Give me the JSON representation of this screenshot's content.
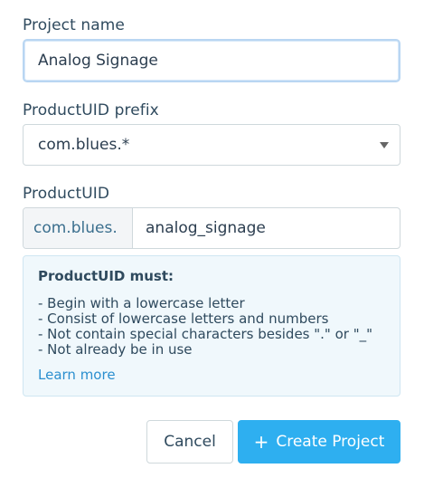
{
  "project_name": {
    "label": "Project name",
    "value": "Analog Signage"
  },
  "prefix": {
    "label": "ProductUID prefix",
    "selected": "com.blues.*"
  },
  "product_uid": {
    "label": "ProductUID",
    "prefix": "com.blues.",
    "value": "analog_signage"
  },
  "info": {
    "title": "ProductUID must:",
    "rules": [
      "- Begin with a lowercase letter",
      "- Consist of lowercase letters and numbers",
      "- Not contain special characters besides \".\" or \"_\"",
      "- Not already be in use"
    ],
    "learn_more": "Learn more"
  },
  "buttons": {
    "cancel": "Cancel",
    "create_icon": "+",
    "create": "Create Project"
  },
  "colors": {
    "accent": "#2eaff0",
    "link": "#2b8fcf",
    "info_bg": "#f0f8fc"
  }
}
